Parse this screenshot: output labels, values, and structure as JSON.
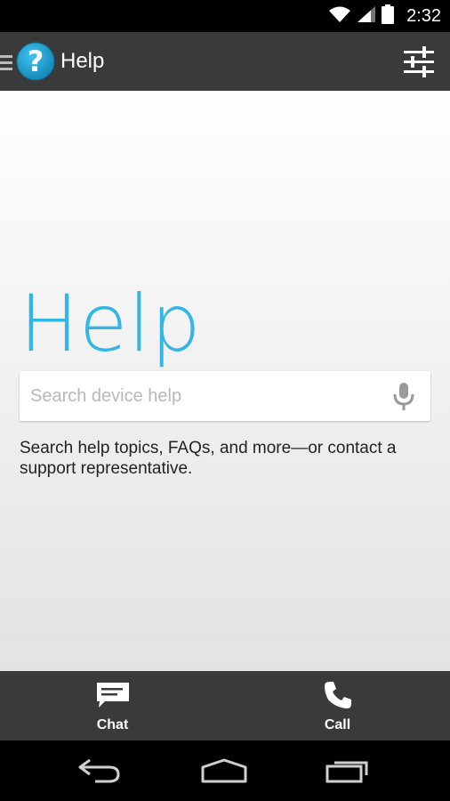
{
  "status_bar": {
    "time": "2:32",
    "icons": [
      "wifi-icon",
      "signal-icon",
      "battery-icon"
    ]
  },
  "action_bar": {
    "title": "Help",
    "app_icon_glyph": "?",
    "icons": [
      "drawer-indicator-icon",
      "help-app-icon",
      "settings-sliders-icon"
    ]
  },
  "main": {
    "hero_title": "Help",
    "search": {
      "placeholder": "Search device help",
      "value": ""
    },
    "description": "Search help topics, FAQs, and more—or contact a support representative."
  },
  "bottom_actions": [
    {
      "label": "Chat",
      "icon": "chat-icon"
    },
    {
      "label": "Call",
      "icon": "phone-icon"
    }
  ],
  "nav_bar": {
    "icons": [
      "back-icon",
      "home-icon",
      "recents-icon"
    ]
  },
  "colors": {
    "accent": "#33b5e5",
    "action_bar": "#3a3a3a",
    "status_bar": "#000000",
    "app_icon": "#1e9fd0"
  }
}
